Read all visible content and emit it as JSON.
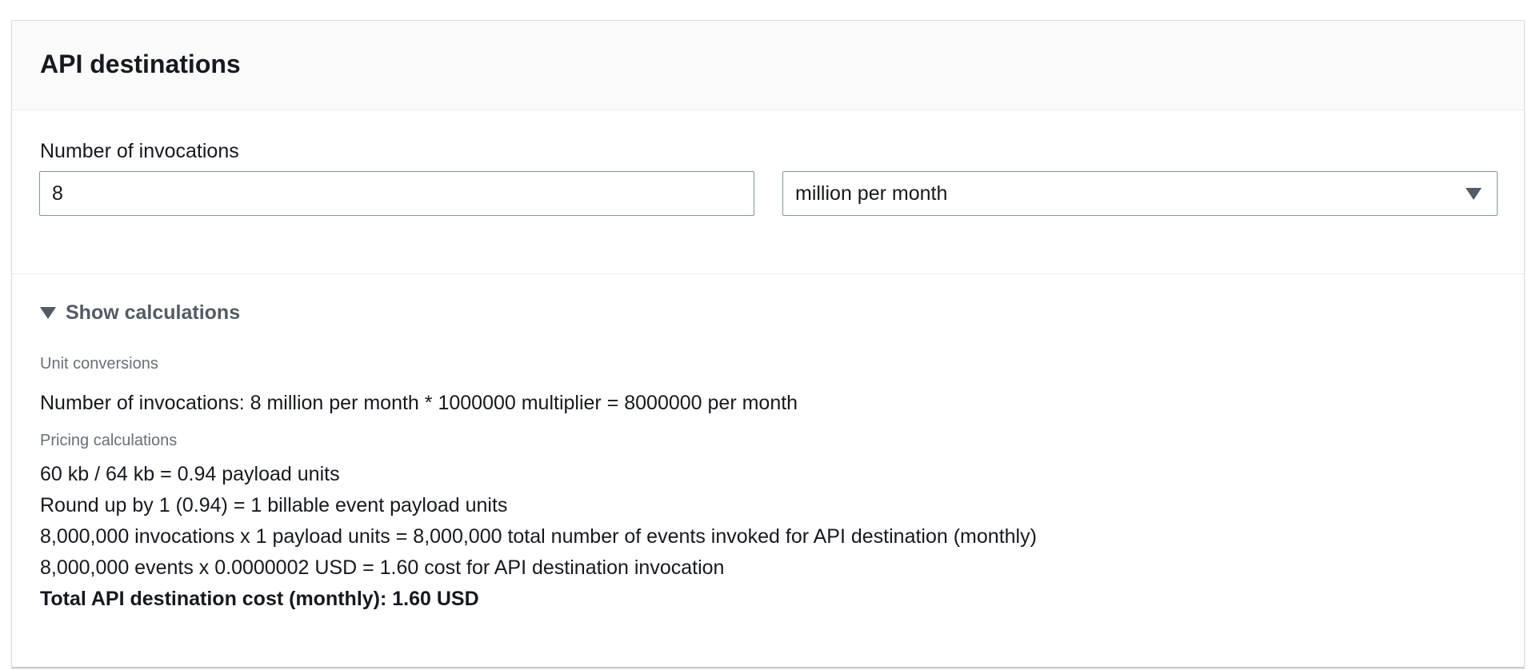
{
  "panel": {
    "title": "API destinations"
  },
  "invocations": {
    "label": "Number of invocations",
    "value": "8",
    "unit_selected": "million per month"
  },
  "calculations": {
    "toggle_label": "Show calculations",
    "unit_conversions_heading": "Unit conversions",
    "unit_conversion_line": "Number of invocations: 8 million per month * 1000000 multiplier = 8000000 per month",
    "pricing_heading": "Pricing calculations",
    "pricing_lines": [
      "60 kb / 64 kb = 0.94 payload units",
      "Round up by 1 (0.94) = 1 billable event payload units",
      "8,000,000 invocations x 1 payload units = 8,000,000 total number of events invoked for API destination (monthly)",
      "8,000,000 events x 0.0000002 USD = 1.60 cost for API destination invocation"
    ],
    "total_line": "Total API destination cost (monthly): 1.60 USD"
  }
}
